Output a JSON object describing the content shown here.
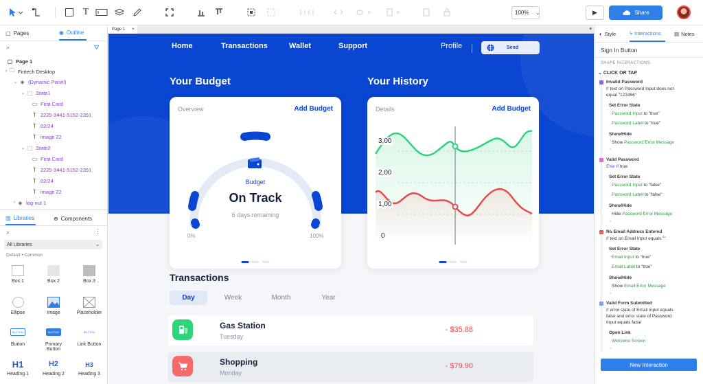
{
  "toolbar": {
    "zoom": "100%",
    "share_label": "Share"
  },
  "left_panel": {
    "tabs": [
      "Pages",
      "Outline"
    ],
    "tree": [
      {
        "label": "Page 1",
        "bold": true
      },
      {
        "label": "Fintech Desktop"
      },
      {
        "label": "(Dynamic Panel)",
        "purple": true
      },
      {
        "label": "State1"
      },
      {
        "label": "First Card",
        "purple": true
      },
      {
        "label": "2225-3441-5152-2351",
        "purple": true
      },
      {
        "label": "02/24",
        "purple": true
      },
      {
        "label": "image 22",
        "purple": true
      },
      {
        "label": "State2"
      },
      {
        "label": "First Card",
        "purple": true
      },
      {
        "label": "2225-3441-5152-2351",
        "purple": true
      },
      {
        "label": "02/24",
        "purple": true
      },
      {
        "label": "image 22",
        "purple": true
      },
      {
        "label": "log-out 1"
      }
    ],
    "lib_tabs": [
      "Libraries",
      "Components"
    ],
    "library_select": "All Libraries",
    "library_path": "Default • Common",
    "widgets": [
      "Box 1",
      "Box 2",
      "Box 3",
      "Ellipse",
      "Image",
      "Placeholder",
      "Button",
      "Primary Button",
      "Link Button",
      "Heading 1",
      "Heading 2",
      "Heading 3"
    ],
    "widget_previews": {
      "button": "BUTTON",
      "h1": "H1",
      "h2": "H2",
      "h3": "H3"
    }
  },
  "canvas": {
    "page_tab": "Page 1",
    "nav": [
      "Home",
      "Transactions",
      "Wallet",
      "Support"
    ],
    "profile": "Profile",
    "send": "Send",
    "budget": {
      "heading": "Your Budget",
      "label": "Overview",
      "action": "Add Budget",
      "caption": "Budget",
      "status": "On Track",
      "remaining": "6 days remaining",
      "min": "0%",
      "max": "100%"
    },
    "history": {
      "heading": "Your History",
      "label": "Details",
      "action": "Add Budget",
      "ticks": [
        "3,00",
        "2,00",
        "1,00",
        "0"
      ]
    },
    "transactions": {
      "heading": "Transactions",
      "periods": [
        "Day",
        "Week",
        "Month",
        "Year"
      ],
      "items": [
        {
          "name": "Gas Station",
          "day": "Tuesday",
          "amount": "- $35.88",
          "color": "#2ed47a"
        },
        {
          "name": "Shopping",
          "day": "Monday",
          "amount": "- $79.90",
          "color": "#f56b6b"
        }
      ]
    }
  },
  "right_panel": {
    "tabs": [
      "Style",
      "Interactions",
      "Notes"
    ],
    "title": "Sign In Button",
    "section": "SHAPE INTERACTIONS",
    "trigger": "CLICK OR TAP",
    "cases": [
      {
        "name": "Invalid Password",
        "cond_kw": "If",
        "cond": "text on Password Input does not",
        "cond2": "equal \"123456\"",
        "color": "#8a63e8",
        "actions": [
          {
            "title": "Set Error State",
            "lines": [
              [
                "Password Input",
                " to \"true\""
              ],
              [
                "Password Label",
                " to \"true\""
              ]
            ]
          },
          {
            "title": "Show/Hide",
            "lines": [
              [
                "Show ",
                "Password Error Message"
              ]
            ]
          }
        ]
      },
      {
        "name": "Valid Password",
        "cond_kw": "Else If",
        "cond": "true",
        "color": "#e06bc8",
        "actions": [
          {
            "title": "Set Error State",
            "lines": [
              [
                "Password Input",
                " to \"false\""
              ],
              [
                "Password Label",
                " to \"false\""
              ]
            ]
          },
          {
            "title": "Show/Hide",
            "lines": [
              [
                "Hide ",
                "Password Error Message"
              ]
            ]
          }
        ]
      },
      {
        "name": "No Email Address Entered",
        "cond_kw": "If",
        "cond": "text on Email Input equals \"\"",
        "color": "#e05b5b",
        "actions": [
          {
            "title": "Set Error State",
            "lines": [
              [
                "Email Input",
                " to \"true\""
              ],
              [
                "Email Label",
                " to \"true\""
              ]
            ]
          },
          {
            "title": "Show/Hide",
            "lines": [
              [
                "Show ",
                "Email Error Message"
              ]
            ]
          }
        ]
      },
      {
        "name": "Valid Form Submitted",
        "cond_kw": "If",
        "cond": "error state of Email Input equals",
        "cond2": "false and error state of Password",
        "cond3": "Input equals false",
        "color": "#7aa7e8",
        "actions": [
          {
            "title": "Open Link",
            "lines": [
              [
                "",
                "Welcome Screen"
              ]
            ]
          }
        ]
      }
    ],
    "new_interaction": "New Interaction"
  }
}
